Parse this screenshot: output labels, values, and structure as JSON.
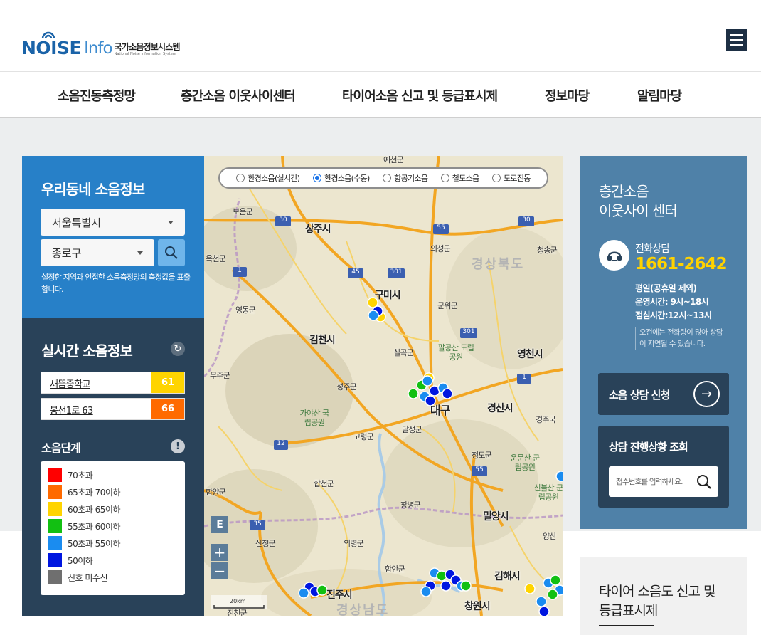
{
  "header": {
    "logo_noise": "NOISE",
    "logo_info": "Info",
    "logo_kr": "국가소음정보시스템",
    "logo_en": "National Noise Information System",
    "menu_icon": "hamburger-menu-icon"
  },
  "nav": {
    "items": [
      "소음진동측정망",
      "층간소음 이웃사이센터",
      "타이어소음 신고 및 등급표시제",
      "정보마당",
      "알림마당"
    ]
  },
  "local": {
    "title": "우리동네 소음정보",
    "city_select": "서울특별시",
    "district_select": "종로구",
    "note": "설정한 지역과 인접한 소음측정망의 측정값을 표출합니다."
  },
  "realtime": {
    "title": "실시간 소음정보",
    "rows": [
      {
        "name": "새뜸중학교",
        "value": "61",
        "color": "#ffd400"
      },
      {
        "name": "봉선1로 63",
        "value": "66",
        "color": "#ff6a00"
      }
    ]
  },
  "levels": {
    "title": "소음단계",
    "items": [
      {
        "label": "70초과",
        "color": "#ff0000"
      },
      {
        "label": "65초과 70이하",
        "color": "#ff6a00"
      },
      {
        "label": "60초과 65이하",
        "color": "#ffd400"
      },
      {
        "label": "55초과 60이하",
        "color": "#12c012"
      },
      {
        "label": "50초과 55이하",
        "color": "#1a8cf0"
      },
      {
        "label": "50이하",
        "color": "#0016e0"
      },
      {
        "label": "신호 미수신",
        "color": "#6f6f6f"
      }
    ]
  },
  "map": {
    "radios": [
      {
        "label": "환경소음(실시간)",
        "checked": false
      },
      {
        "label": "환경소음(수동)",
        "checked": true
      },
      {
        "label": "항공기소음",
        "checked": false
      },
      {
        "label": "철도소음",
        "checked": false
      },
      {
        "label": "도로진동",
        "checked": false
      }
    ],
    "e_button": "E",
    "zoom_in": "+",
    "zoom_out": "−",
    "scale": "20km",
    "cities": [
      "상주시",
      "구미시",
      "김천시",
      "대구",
      "영천시",
      "경산시",
      "밀양시",
      "김해시",
      "진주시",
      "창원시"
    ],
    "towns": [
      "예천군",
      "보은군",
      "의성군",
      "청송군",
      "옥천군",
      "군위군",
      "영동군",
      "칠곡군",
      "무주군",
      "성주군",
      "달성군",
      "고령군",
      "경주국",
      "청도군",
      "합천군",
      "창녕군",
      "의령군",
      "함양군",
      "산청군",
      "함안군",
      "진천군",
      "양산"
    ],
    "regions": [
      "경상북도",
      "경상남도"
    ],
    "parks": [
      "팔공산 도립공원",
      "가야산 국립공원",
      "운문산 군립공원",
      "신불산 군립공원"
    ],
    "road_numbers": [
      "30",
      "55",
      "30",
      "1",
      "45",
      "301",
      "301",
      "1",
      "12",
      "55",
      "35"
    ]
  },
  "center": {
    "title_line1": "층간소음",
    "title_line2": "이웃사이 센터",
    "phone_label": "전화상담",
    "phone": "1661-2642",
    "hours_line1": "평일(공휴일 제외)",
    "hours_line2": "운영시간: 9시~18시",
    "hours_line3": "점심시간:12시~13시",
    "note": "오전에는 전화량이 많아 상담이 지연될 수 있습니다.",
    "apply_button": "소음 상담 신청",
    "status_title": "상담 진행상황 조회",
    "receipt_placeholder": "접수번호를 입력하세요."
  },
  "tire": {
    "title_line1": "타이어 소음도 신고 및",
    "title_line2": "등급표시제"
  }
}
